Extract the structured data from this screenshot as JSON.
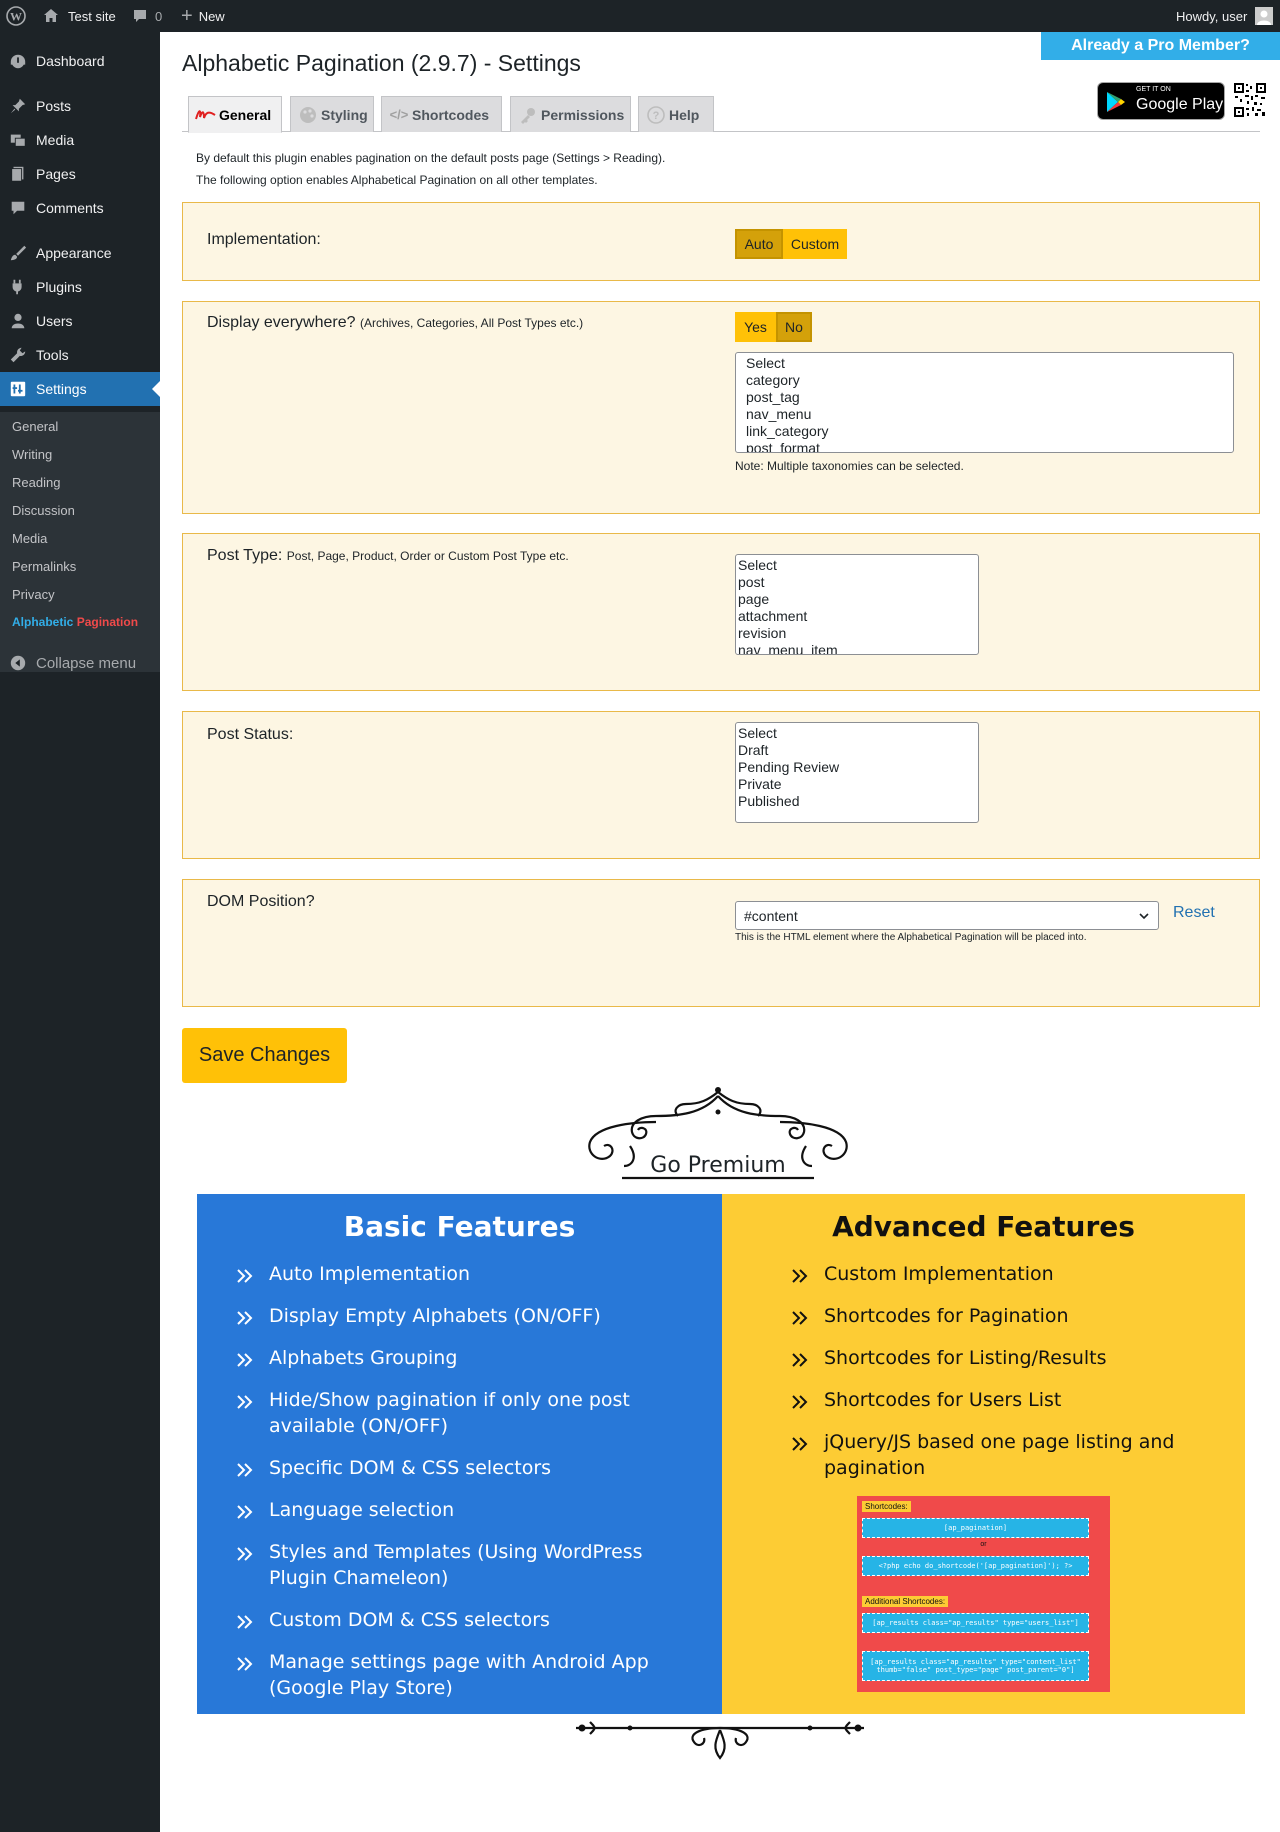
{
  "adminbar": {
    "site_name": "Test site",
    "comments_count": "0",
    "new_label": "New",
    "howdy": "Howdy, user"
  },
  "sidebar": {
    "items": [
      {
        "label": "Dashboard",
        "icon": "dashboard-icon"
      },
      {
        "label": "Posts",
        "icon": "pin-icon"
      },
      {
        "label": "Media",
        "icon": "media-icon"
      },
      {
        "label": "Pages",
        "icon": "pages-icon"
      },
      {
        "label": "Comments",
        "icon": "comment-icon"
      },
      {
        "label": "Appearance",
        "icon": "brush-icon"
      },
      {
        "label": "Plugins",
        "icon": "plug-icon"
      },
      {
        "label": "Users",
        "icon": "user-icon"
      },
      {
        "label": "Tools",
        "icon": "wrench-icon"
      },
      {
        "label": "Settings",
        "icon": "settings-icon"
      }
    ],
    "submenu": [
      "General",
      "Writing",
      "Reading",
      "Discussion",
      "Media",
      "Permalinks",
      "Privacy"
    ],
    "plugin_part1": "Alphabetic",
    "plugin_part2": "Pagination",
    "collapse": "Collapse menu"
  },
  "header": {
    "title": "Alphabetic Pagination (2.9.7) - Settings",
    "pro_button": "Already a Pro Member?",
    "gplay_small": "GET IT ON",
    "gplay_big": "Google Play"
  },
  "tabs": [
    {
      "label": "General",
      "active": true
    },
    {
      "label": "Styling",
      "active": false
    },
    {
      "label": "Shortcodes",
      "active": false
    },
    {
      "label": "Permissions",
      "active": false
    },
    {
      "label": "Help",
      "active": false
    }
  ],
  "intro": {
    "line1": "By default this plugin enables pagination on the default posts page (Settings > Reading).",
    "line2": "The following option enables Alphabetical Pagination on all other templates."
  },
  "implementation": {
    "label": "Implementation:",
    "options": [
      "Auto",
      "Custom"
    ],
    "selected": "Auto"
  },
  "display_everywhere": {
    "label": "Display everywhere?",
    "hint": "(Archives, Categories, All Post Types etc.)",
    "options": [
      "Yes",
      "No"
    ],
    "selected": "No",
    "taxonomies": [
      "Select",
      "category",
      "post_tag",
      "nav_menu",
      "link_category",
      "post_format"
    ],
    "note": "Note: Multiple taxonomies can be selected."
  },
  "post_type": {
    "label": "Post Type:",
    "hint": "Post, Page, Product, Order or Custom Post Type etc.",
    "options": [
      "Select",
      "post",
      "page",
      "attachment",
      "revision",
      "nav_menu_item"
    ]
  },
  "post_status": {
    "label": "Post Status:",
    "options": [
      "Select",
      "Draft",
      "Pending Review",
      "Private",
      "Published"
    ]
  },
  "dom_position": {
    "label": "DOM Position?",
    "value": "#content",
    "reset": "Reset",
    "help": "This is the HTML element where the Alphabetical Pagination will be placed into."
  },
  "save_button": "Save Changes",
  "premium": {
    "heading": "Go Premium",
    "basic_title": "Basic Features",
    "basic_items": [
      "Auto Implementation",
      "Display Empty Alphabets (ON/OFF)",
      "Alphabets Grouping",
      "Hide/Show pagination if only one post available (ON/OFF)",
      "Specific DOM & CSS selectors",
      "Language selection",
      "Styles and Templates (Using WordPress Plugin Chameleon)",
      "Custom DOM & CSS selectors",
      "Manage settings page with Android App (Google Play Store)"
    ],
    "advanced_title": "Advanced Features",
    "advanced_items": [
      "Custom Implementation",
      "Shortcodes for Pagination",
      "Shortcodes for Listing/Results",
      "Shortcodes for Users List",
      "jQuery/JS based one page listing and pagination"
    ],
    "shortcodes": {
      "tag1": "Shortcodes:",
      "sc1": "[ap_pagination]",
      "or": "or",
      "sc2": "<?php echo do_shortcode('[ap_pagination]'); ?>",
      "tag2": "Additional Shortcodes:",
      "sc3": "[ap_results class=\"ap_results\" type=\"users_list\"]",
      "sc4": "[ap_results class=\"ap_results\" type=\"content_list\" thumb=\"false\" post_type=\"page\" post_parent=\"0\"]"
    }
  },
  "colors": {
    "accent": "#2271b1",
    "panel_bg": "#fdf6e3",
    "panel_border": "#e9b949",
    "toggle": "#ffc107",
    "basic_bg": "#2878d8",
    "advanced_bg": "#fdcc34",
    "pro_button": "#32aee8"
  }
}
